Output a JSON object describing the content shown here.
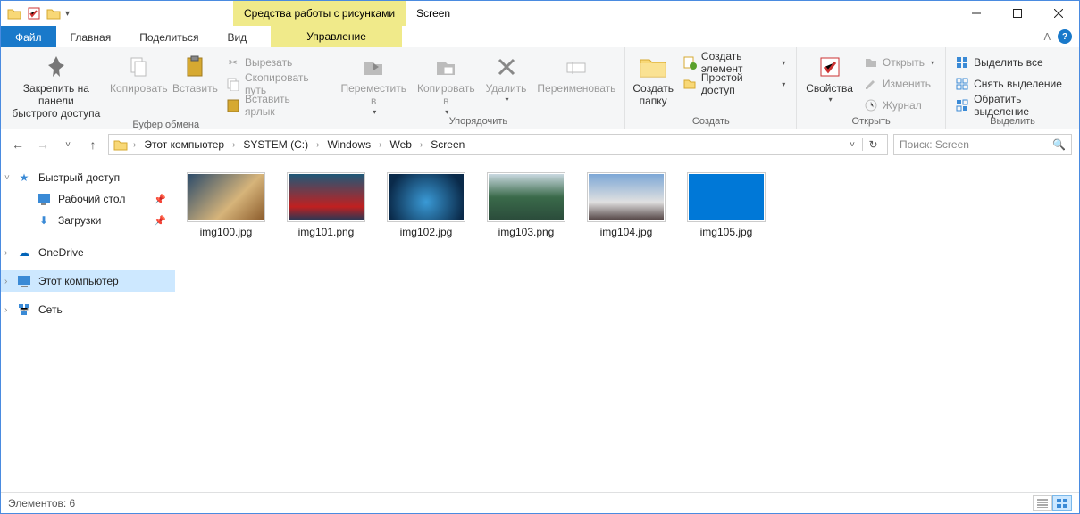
{
  "title": "Screen",
  "contextual_tab": "Средства работы с рисунками",
  "tabs": {
    "file": "Файл",
    "home": "Главная",
    "share": "Поделиться",
    "view": "Вид",
    "manage": "Управление"
  },
  "ribbon": {
    "clipboard": {
      "label": "Буфер обмена",
      "pin": "Закрепить на панели\nбыстрого доступа",
      "copy": "Копировать",
      "paste": "Вставить",
      "cut": "Вырезать",
      "copy_path": "Скопировать путь",
      "paste_shortcut": "Вставить ярлык"
    },
    "organize": {
      "label": "Упорядочить",
      "move_to": "Переместить\nв",
      "copy_to": "Копировать\nв",
      "delete": "Удалить",
      "rename": "Переименовать"
    },
    "new": {
      "label": "Создать",
      "new_folder": "Создать\nпапку",
      "new_item": "Создать элемент",
      "easy_access": "Простой доступ"
    },
    "open": {
      "label": "Открыть",
      "properties": "Свойства",
      "open": "Открыть",
      "edit": "Изменить",
      "history": "Журнал"
    },
    "select": {
      "label": "Выделить",
      "select_all": "Выделить все",
      "select_none": "Снять выделение",
      "invert": "Обратить выделение"
    }
  },
  "breadcrumbs": [
    "Этот компьютер",
    "SYSTEM (C:)",
    "Windows",
    "Web",
    "Screen"
  ],
  "search_placeholder": "Поиск: Screen",
  "nav": {
    "quick": "Быстрый доступ",
    "desktop": "Рабочий стол",
    "downloads": "Загрузки",
    "onedrive": "OneDrive",
    "this_pc": "Этот компьютер",
    "network": "Сеть"
  },
  "files": [
    {
      "name": "img100.jpg",
      "bg": "linear-gradient(135deg,#2a4a6a 0%,#d6b47a 60%,#8a5a2a 100%)"
    },
    {
      "name": "img101.png",
      "bg": "linear-gradient(180deg,#1a5a7a 0%,#c02020 70%,#1a3a5a 100%)"
    },
    {
      "name": "img102.jpg",
      "bg": "radial-gradient(circle at 50% 60%,#3a9ad6 0%,#0a2a4a 80%)"
    },
    {
      "name": "img103.png",
      "bg": "linear-gradient(180deg,#cfdde6 0%,#3a6a4a 50%,#2a4a3a 100%)"
    },
    {
      "name": "img104.jpg",
      "bg": "linear-gradient(180deg,#7aa6d6 0%,#e0e0e0 60%,#4a3a3a 100%)"
    },
    {
      "name": "img105.jpg",
      "bg": "#0078d7"
    }
  ],
  "status": {
    "items": "Элементов: 6"
  }
}
